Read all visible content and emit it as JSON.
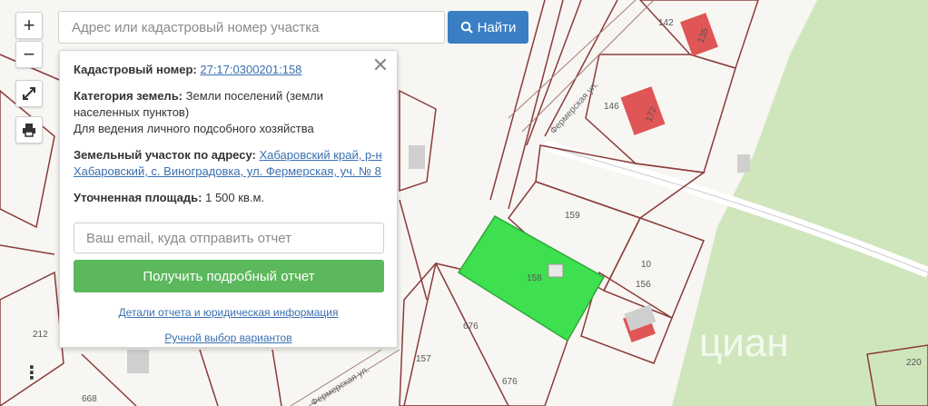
{
  "search": {
    "placeholder": "Адрес или кадастровый номер участка",
    "button_label": "Найти"
  },
  "controls": {
    "zoom_in": "+",
    "zoom_out": "−",
    "more": "⋮"
  },
  "popup": {
    "cadastral_label": "Кадастровый номер:",
    "cadastral_value": "27:17:0300201:158",
    "category_label": "Категория земель:",
    "category_value": "Земли поселений (земли населенных пунктов)",
    "usage": "Для ведения личного подсобного хозяйства",
    "address_label": "Земельный участок по адресу:",
    "address_value": "Хабаровский край, р-н Хабаровский, с. Виноградовка, ул. Фермерская, уч. № 8",
    "area_label": "Уточненная площадь:",
    "area_value": "1 500 кв.м.",
    "email_placeholder": "Ваш email, куда отправить отчет",
    "report_button": "Получить подробный отчет",
    "details_link": "Детали отчета и юридическая информация",
    "manual_link": "Ручной выбор вариантов"
  },
  "map": {
    "street_name": "Фермерская ул.",
    "street_name_lower": "Фермерская ул.",
    "parcel_labels": {
      "p142": "142",
      "p146": "146",
      "p159": "159",
      "p10": "10",
      "p156": "156",
      "p676a": "676",
      "p676b": "676",
      "p157": "157",
      "p212": "212",
      "p668": "668",
      "p220": "220",
      "p158": "158",
      "h172": "172",
      "h135": "135"
    },
    "watermark": "циан",
    "highlight_color": "#3ee04f",
    "forest_color": "#cfe6bd"
  }
}
